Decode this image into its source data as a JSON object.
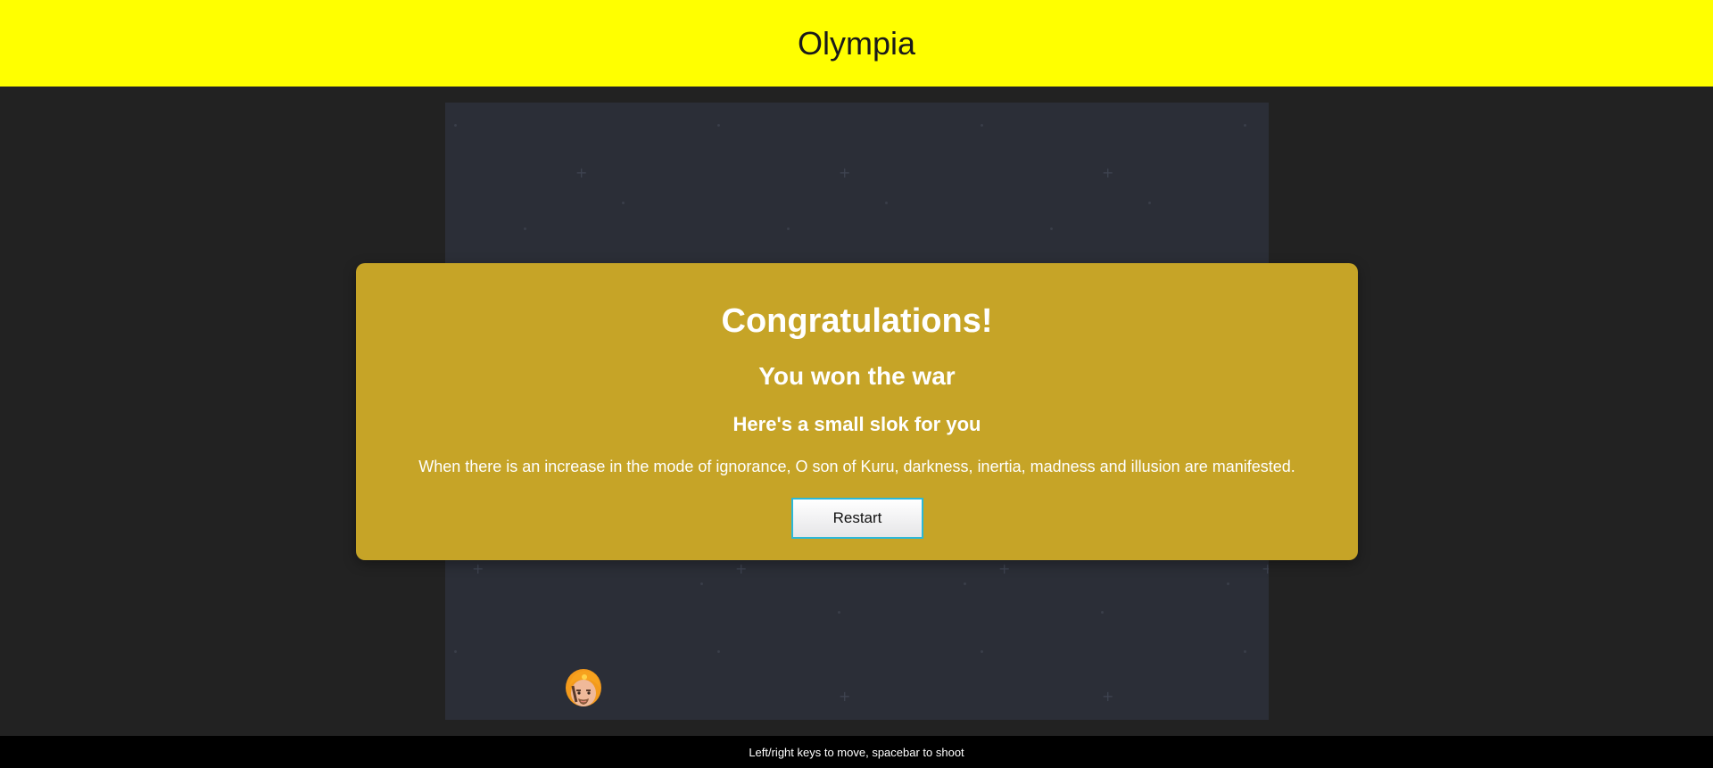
{
  "header": {
    "title": "Olympia",
    "background": "#ffff00"
  },
  "game": {
    "background": "#2b2e37",
    "player_icon": "warrior-face-icon"
  },
  "modal": {
    "title": "Congratulations!",
    "subtitle": "You won the war",
    "heading": "Here's a small slok for you",
    "quote": "When there is an increase in the mode of ignorance, O son of Kuru, darkness, inertia, madness and illusion are manifested.",
    "restart_label": "Restart",
    "background": "#c6a427",
    "button_border": "#2bb8d8"
  },
  "footer": {
    "instructions": "Left/right keys to move, spacebar to shoot"
  }
}
